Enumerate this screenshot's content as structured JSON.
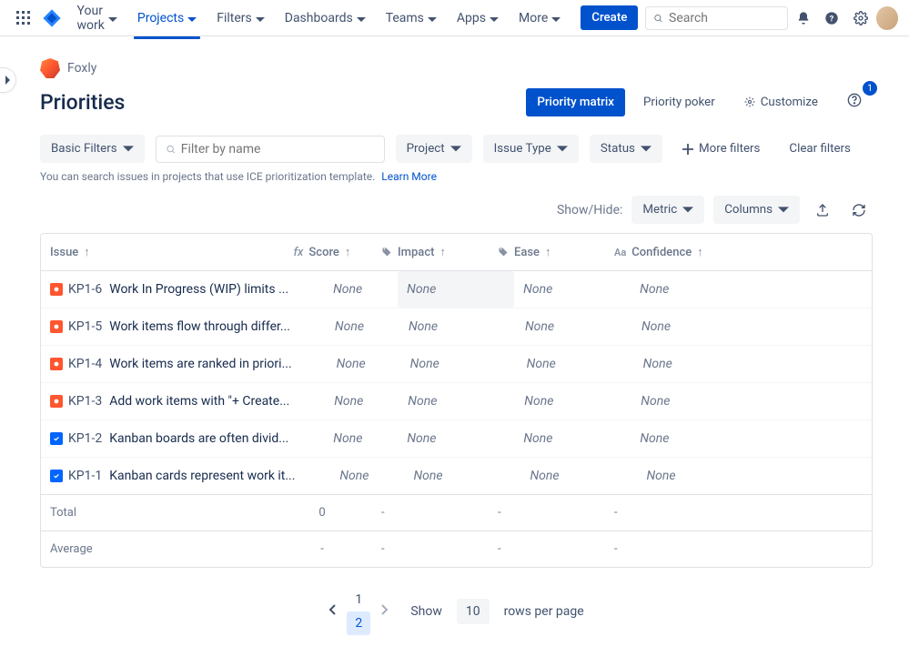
{
  "nav": {
    "items": [
      {
        "label": "Your work"
      },
      {
        "label": "Projects"
      },
      {
        "label": "Filters"
      },
      {
        "label": "Dashboards"
      },
      {
        "label": "Teams"
      },
      {
        "label": "Apps"
      },
      {
        "label": "More"
      }
    ],
    "active_index": 1,
    "create_label": "Create",
    "search_placeholder": "Search"
  },
  "project_name": "Foxly",
  "page_title": "Priorities",
  "actions": {
    "priority_matrix": "Priority matrix",
    "priority_poker": "Priority poker",
    "customize": "Customize",
    "help_badge": "1"
  },
  "filters": {
    "basic_filters": "Basic Filters",
    "filter_placeholder": "Filter by name",
    "project": "Project",
    "issue_type": "Issue Type",
    "status": "Status",
    "more_filters": "More filters",
    "clear_filters": "Clear filters"
  },
  "hint": {
    "text": "You can search issues in projects that use ICE prioritization template.",
    "link": "Learn More"
  },
  "showhide": {
    "label": "Show/Hide:",
    "metric": "Metric",
    "columns": "Columns"
  },
  "columns": {
    "issue": "Issue",
    "score": "Score",
    "impact": "Impact",
    "ease": "Ease",
    "confidence": "Confidence"
  },
  "rows": [
    {
      "type": "bug",
      "key": "KP1-6",
      "summary": "Work In Progress (WIP) limits ...",
      "score": "None",
      "impact": "None",
      "ease": "None",
      "confidence": "None"
    },
    {
      "type": "bug",
      "key": "KP1-5",
      "summary": "Work items flow through differ...",
      "score": "None",
      "impact": "None",
      "ease": "None",
      "confidence": "None"
    },
    {
      "type": "bug",
      "key": "KP1-4",
      "summary": "Work items are ranked in priori...",
      "score": "None",
      "impact": "None",
      "ease": "None",
      "confidence": "None"
    },
    {
      "type": "bug",
      "key": "KP1-3",
      "summary": "Add work items with \"+ Create...",
      "score": "None",
      "impact": "None",
      "ease": "None",
      "confidence": "None"
    },
    {
      "type": "task",
      "key": "KP1-2",
      "summary": "Kanban boards are often divid...",
      "score": "None",
      "impact": "None",
      "ease": "None",
      "confidence": "None"
    },
    {
      "type": "task",
      "key": "KP1-1",
      "summary": "Kanban cards represent work it...",
      "score": "None",
      "impact": "None",
      "ease": "None",
      "confidence": "None"
    }
  ],
  "summary": {
    "total_label": "Total",
    "total_score": "0",
    "dash": "-",
    "average_label": "Average",
    "average_score": "-"
  },
  "pagination": {
    "pages": [
      "1",
      "2"
    ],
    "current": 2,
    "show_label": "Show",
    "per_page": "10",
    "rows_per_page_label": "rows per page"
  }
}
